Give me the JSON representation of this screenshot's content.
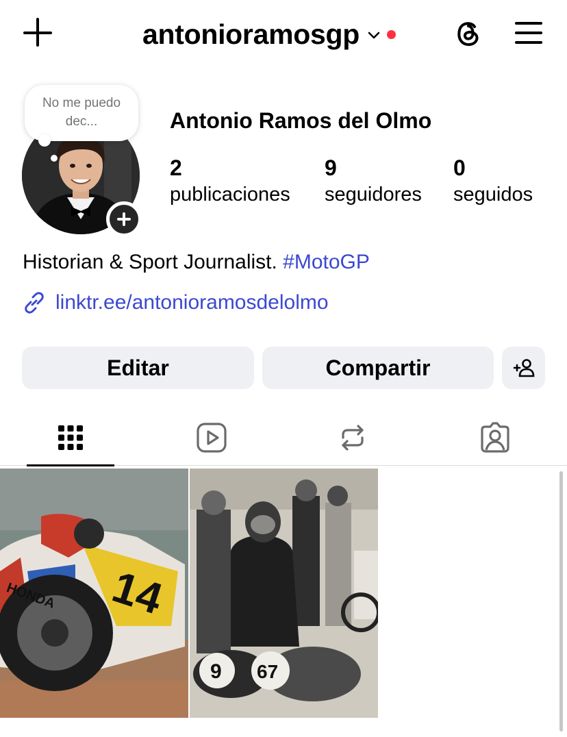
{
  "header": {
    "username": "antonioramosgp",
    "icons": [
      "plus-icon",
      "chevron-down-icon",
      "notification-dot",
      "threads-icon",
      "hamburger-menu-icon"
    ]
  },
  "note": {
    "text": "No me puedo dec..."
  },
  "profile": {
    "full_name": "Antonio Ramos del Olmo",
    "stats": {
      "posts": {
        "value": "2",
        "label": "publicaciones"
      },
      "followers": {
        "value": "9",
        "label": "seguidores"
      },
      "following": {
        "value": "0",
        "label": "seguidos"
      }
    },
    "bio_text": "Historian & Sport Journalist.",
    "bio_hashtag": "#MotoGP",
    "link": "linktr.ee/antonioramosdelolmo"
  },
  "actions": {
    "edit_label": "Editar",
    "share_label": "Compartir"
  },
  "tabs": [
    {
      "name": "posts",
      "icon": "grid-icon",
      "active": true
    },
    {
      "name": "reels",
      "icon": "reels-icon",
      "active": false
    },
    {
      "name": "reposts",
      "icon": "repost-icon",
      "active": false
    },
    {
      "name": "tagged",
      "icon": "tagged-icon",
      "active": false
    }
  ],
  "posts": [
    {
      "icon": "motorcycle-racing-photo"
    },
    {
      "icon": "vintage-racing-photo"
    }
  ],
  "colors": {
    "link": "#3b48d1",
    "notification": "#ff3040",
    "button_bg": "#eff0f3",
    "note_text": "#737373"
  }
}
